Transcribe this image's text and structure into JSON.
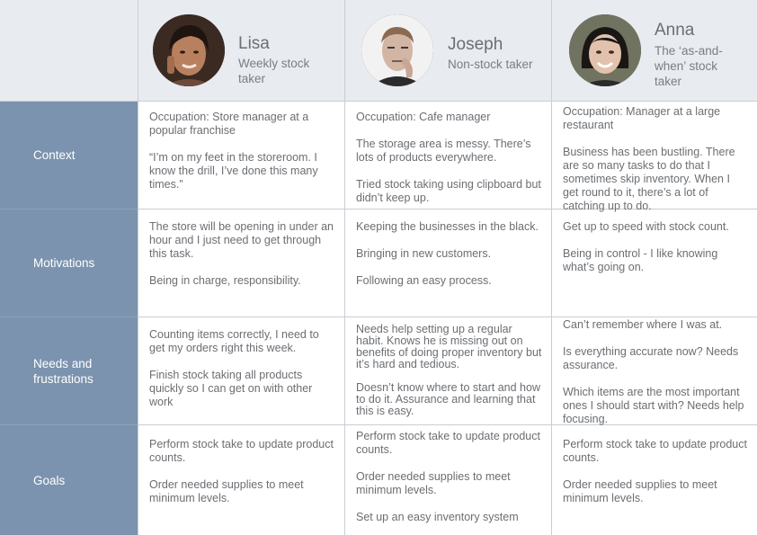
{
  "personas": [
    {
      "name": "Lisa",
      "role": "Weekly stock taker"
    },
    {
      "name": "Joseph",
      "role": "Non-stock taker"
    },
    {
      "name": "Anna",
      "role": "The ‘as-and-when’ stock taker"
    }
  ],
  "rows": [
    {
      "label": "Context",
      "cells": [
        [
          "Occupation: Store manager at a popular franchise",
          "“I’m on my feet in the storeroom. I know the drill, I’ve done this many times.”"
        ],
        [
          "Occupation: Cafe manager",
          "The storage area is messy. There’s lots of products everywhere.",
          "Tried stock taking using clipboard but didn’t keep up."
        ],
        [
          "Occupation: Manager at a large restaurant",
          "Business has been bustling. There are so many tasks to do that I sometimes skip inventory. When I get round to it, there’s a lot of catching up to do."
        ]
      ]
    },
    {
      "label": "Motivations",
      "cells": [
        [
          "The store will be opening in under an hour and I just need to get through this task.",
          "Being in charge, responsibility."
        ],
        [
          "Keeping the businesses in the black.",
          "Bringing in new customers.",
          "Following an easy process."
        ],
        [
          "Get up to speed with stock count.",
          "Being in control - I like knowing what’s going on."
        ]
      ]
    },
    {
      "label": "Needs and frustrations",
      "cells": [
        [
          "Counting items correctly, I need to get my orders right this week.",
          "Finish stock taking all products quickly so I can get on with other work"
        ],
        [
          "Needs help setting up a regular habit. Knows he is missing out on benefits of doing proper inventory but it’s hard and tedious.",
          "Doesn’t know where to start and how to do it. Assurance and learning that this is easy."
        ],
        [
          "Can’t remember where I was at.",
          "Is everything accurate now? Needs assurance.",
          "Which items are the most important ones I should start with? Needs help focusing."
        ]
      ]
    },
    {
      "label": "Goals",
      "cells": [
        [
          "Perform stock take to update product counts.",
          "Order needed supplies to meet minimum levels."
        ],
        [
          "Perform stock take to update product counts.",
          "Order needed supplies to meet minimum levels.",
          "Set up an easy inventory system"
        ],
        [
          "Perform stock take to update product counts.",
          "Order needed supplies to meet minimum levels."
        ]
      ]
    }
  ]
}
